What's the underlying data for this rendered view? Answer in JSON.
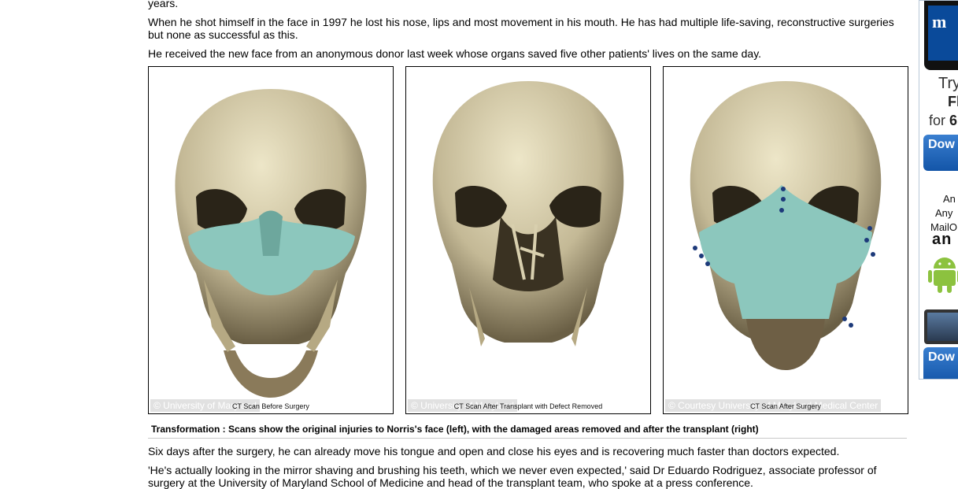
{
  "article": {
    "p_years": "years.",
    "p1": "When he shot himself in the face in 1997 he lost his nose, lips and most movement in his mouth. He has had multiple life-saving, reconstructive surgeries but none as successful as this.",
    "p2": "He received the new face from an anonymous donor last week whose organs saved five other patients' lives on the same day.",
    "p3": "Six days after the surgery, he can already move his tongue and open and close his eyes and is recovering much faster than doctors expected.",
    "p4": "'He's actually looking in the mirror shaving and brushing his teeth, which we never even expected,' said Dr Eduardo Rodriguez, associate professor of surgery at the University of Maryland School of Medicine and head of the transplant team, who spoke at a press conference."
  },
  "images": [
    {
      "credit": "© University of Maryland",
      "label": "CT Scan Before Surgery"
    },
    {
      "credit": "© University of Maryland",
      "label": "CT Scan After Transplant with Defect Removed"
    },
    {
      "credit": "© Courtesy University of Maryland Medical Center",
      "label": "CT Scan After Surgery"
    }
  ],
  "caption": "Transformation : Scans show the original injuries to Norris's face (left), with the damaged areas removed and after the transplant (right)",
  "ad": {
    "try": "Try",
    "f": "Fl",
    "for": "for ",
    "for_bold": "6",
    "download1": "Dow it",
    "line_a": "An",
    "line_b": "Any",
    "line_c": "MailO",
    "brand": "an",
    "download2": "Dow it",
    "logo": "m"
  },
  "colors": {
    "bone": "#c9c0a0",
    "implant": "#8cc7bd",
    "link_blue": "#1355a8"
  }
}
